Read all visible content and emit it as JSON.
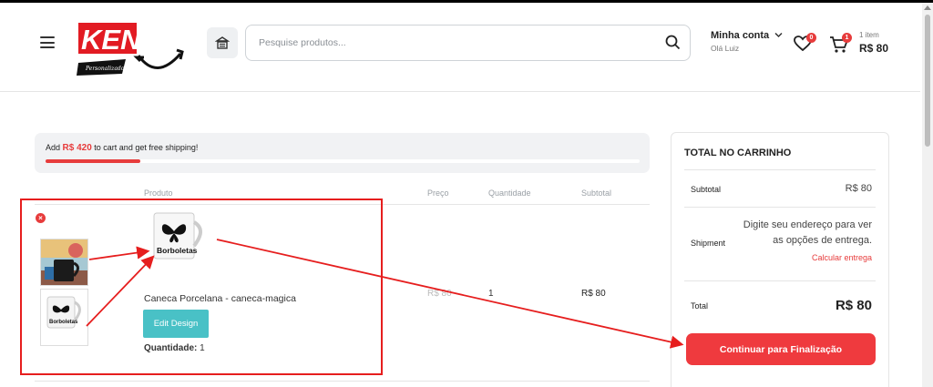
{
  "header": {
    "logo_text": "KENKÉ",
    "logo_sub": "Personalizados",
    "search": {
      "placeholder": "Pesquise produtos..."
    },
    "account": {
      "label": "Minha conta",
      "greeting": "Olá Luiz"
    },
    "wishlist": {
      "count": "0"
    },
    "cart": {
      "count": "1",
      "items_label": "1 item",
      "total": "R$ 80"
    }
  },
  "shipping_notice": {
    "prefix": "Add",
    "amount": "R$ 420",
    "suffix": "to cart and get free shipping!",
    "progress_fraction": 0.16
  },
  "table": {
    "headers": {
      "product": "Produto",
      "price": "Preço",
      "quantity": "Quantidade",
      "subtotal": "Subtotal"
    },
    "rows": [
      {
        "remove": "×",
        "mug_text": "Borboletas",
        "name": "Caneca Porcelana - caneca-magica",
        "edit_label": "Edit Design",
        "qty_label": "Quantidade:",
        "qty_value": "1",
        "price": "R$ 80",
        "quantity": "1",
        "subtotal": "R$ 80"
      }
    ]
  },
  "summary": {
    "title": "TOTAL NO CARRINHO",
    "subtotal_label": "Subtotal",
    "subtotal_value": "R$ 80",
    "shipment_label": "Shipment",
    "shipment_info": "Digite seu endereço para ver as opções de entrega.",
    "calc_link": "Calcular entrega",
    "total_label": "Total",
    "total_value": "R$ 80",
    "checkout_label": "Continuar para Finalização"
  },
  "colors": {
    "accent": "#e73c3c",
    "edit_button": "#49c1c6",
    "annotation": "#e61e1e"
  }
}
